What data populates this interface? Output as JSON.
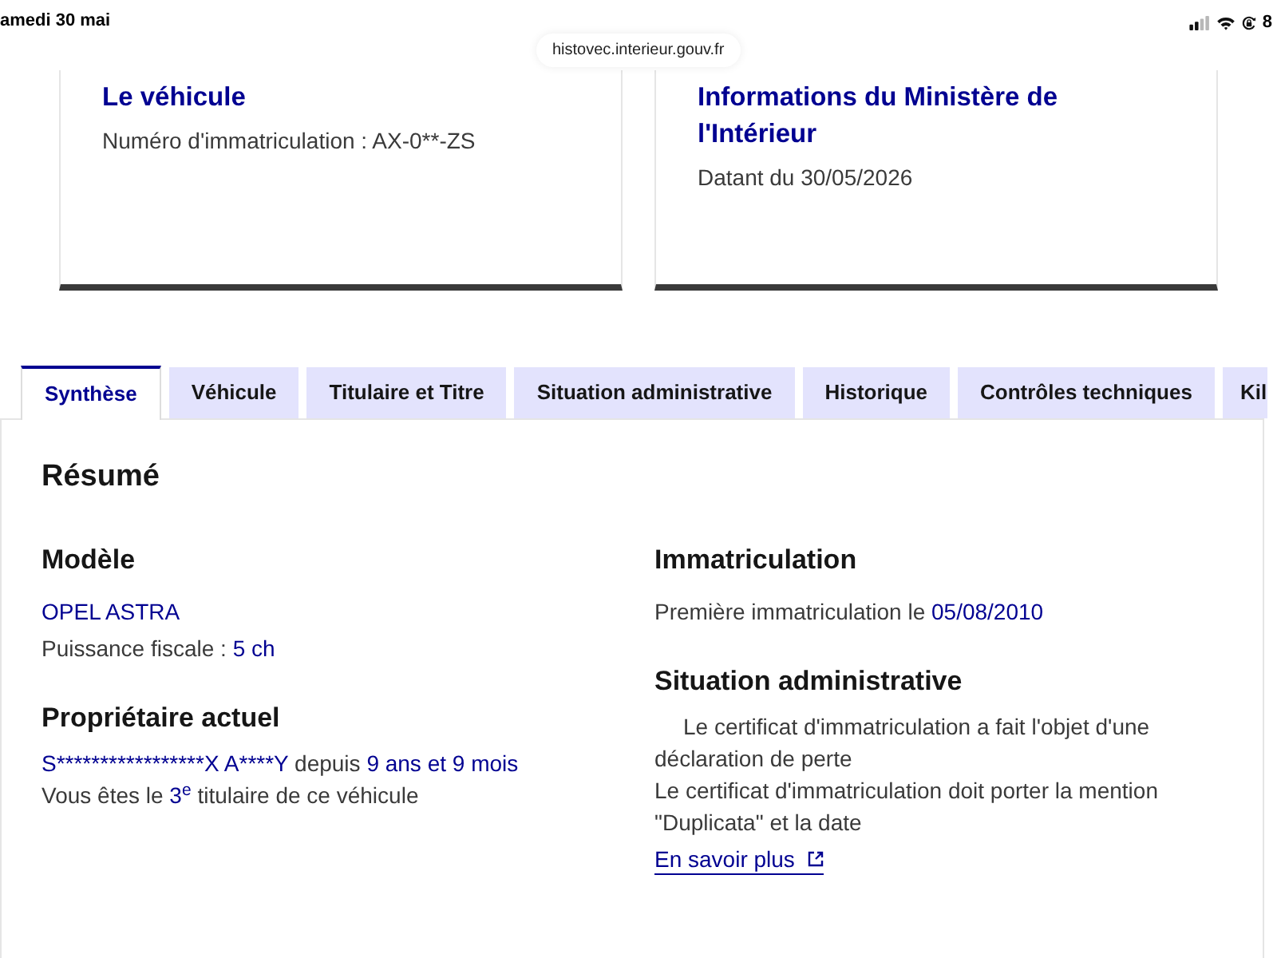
{
  "status_bar": {
    "date": "amedi 30 mai",
    "battery": "8"
  },
  "address_bar": {
    "url": "histovec.interieur.gouv.fr"
  },
  "cards": [
    {
      "title": "Le véhicule",
      "text": "Numéro d'immatriculation : AX-0**-ZS"
    },
    {
      "title": "Informations du Ministère de l'Intérieur",
      "text": "Datant du 30/05/2026"
    }
  ],
  "tabs": [
    {
      "label": "Synthèse",
      "selected": true
    },
    {
      "label": "Véhicule",
      "selected": false
    },
    {
      "label": "Titulaire et Titre",
      "selected": false
    },
    {
      "label": "Situation administrative",
      "selected": false
    },
    {
      "label": "Historique",
      "selected": false
    },
    {
      "label": "Contrôles techniques",
      "selected": false
    },
    {
      "label": "Kil",
      "selected": false
    }
  ],
  "panel": {
    "title": "Résumé",
    "columns": [
      {
        "sections": [
          {
            "heading": "Modèle",
            "kind": "fields",
            "lines": [
              {
                "parts": [
                  {
                    "text": "OPEL ASTRA",
                    "emphasis": true
                  }
                ]
              },
              {
                "parts": [
                  {
                    "text": "Puissance fiscale :",
                    "emphasis": false
                  },
                  {
                    "text": "5 ch",
                    "emphasis": true
                  }
                ]
              }
            ]
          },
          {
            "heading": "Propriétaire actuel",
            "kind": "paragraph",
            "lines": [
              {
                "parts": [
                  {
                    "text": "S*****************X A****Y",
                    "emphasis": true
                  },
                  {
                    "text": "depuis",
                    "emphasis": false
                  },
                  {
                    "text": "9 ans et 9 mois",
                    "emphasis": true
                  }
                ]
              },
              {
                "parts": [
                  {
                    "text": "Vous êtes le",
                    "emphasis": false
                  },
                  {
                    "text": "3",
                    "emphasis": true
                  },
                  {
                    "text": "e",
                    "emphasis": true,
                    "raised": true
                  },
                  {
                    "text": "titulaire de ce véhicule",
                    "emphasis": false
                  }
                ]
              }
            ]
          }
        ]
      },
      {
        "sections": [
          {
            "heading": "Immatriculation",
            "kind": "fields",
            "lines": [
              {
                "parts": [
                  {
                    "text": "Première immatriculation le",
                    "emphasis": false
                  },
                  {
                    "text": "05/08/2010",
                    "emphasis": true
                  }
                ]
              }
            ]
          },
          {
            "heading": "Situation administrative",
            "kind": "paragraph",
            "lines": [
              {
                "indented": true,
                "parts": [
                  {
                    "text": "Le certificat d'immatriculation a fait l'objet d'une déclaration de perte",
                    "emphasis": false
                  }
                ]
              },
              {
                "parts": [
                  {
                    "text": "Le certificat d'immatriculation doit porter la mention \"Duplicata\" et la date",
                    "emphasis": false
                  }
                ]
              }
            ],
            "link": {
              "label": "En savoir plus"
            }
          }
        ]
      }
    ]
  }
}
